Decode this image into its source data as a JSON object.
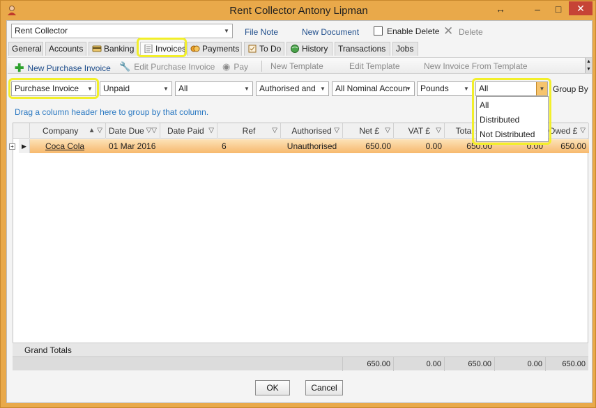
{
  "window": {
    "title": "Rent Collector Antony Lipman",
    "move_glyph": "↔",
    "min_glyph": "–",
    "max_glyph": "□",
    "close_glyph": "✕"
  },
  "top": {
    "record_select": "Rent Collector",
    "file_note": "File Note",
    "new_document": "New Document",
    "enable_delete_label": "Enable Delete",
    "delete_label": "Delete"
  },
  "tabs": [
    {
      "label": "General"
    },
    {
      "label": "Accounts"
    },
    {
      "label": "Banking"
    },
    {
      "label": "Invoices"
    },
    {
      "label": "Payments"
    },
    {
      "label": "To Do"
    },
    {
      "label": "History"
    },
    {
      "label": "Transactions"
    },
    {
      "label": "Jobs"
    }
  ],
  "toolbar": {
    "new_purchase_invoice": "New Purchase Invoice",
    "edit_purchase_invoice": "Edit Purchase Invoice",
    "pay": "Pay",
    "new_template": "New  Template",
    "edit_template": "Edit Template",
    "new_invoice_from_template": "New Invoice From Template"
  },
  "filters": {
    "invoice_type": "Purchase Invoice",
    "status": "Unpaid",
    "period": "All",
    "authorised": "Authorised and",
    "nominal": "All Nominal Accoun",
    "currency": "Pounds",
    "distribution": "All",
    "group_by_label": "Group By"
  },
  "distribution_options": [
    "All",
    "Distributed",
    "Not Distributed"
  ],
  "grid": {
    "drag_hint": "Drag a column header here to group by that column.",
    "columns": [
      "Company",
      "Date Due",
      "Date Paid",
      "Ref",
      "Authorised",
      "Net £",
      "VAT £",
      "Total £",
      "",
      "Owed £"
    ],
    "rows": [
      {
        "company": "Coca Cola",
        "date_due": "01 Mar 2016",
        "date_paid": "",
        "ref": "6",
        "authorised": "Unauthorised",
        "net": "650.00",
        "vat": "0.00",
        "total": "650.00",
        "col9": "0.00",
        "owed": "650.00"
      }
    ],
    "grand_totals_label": "Grand Totals",
    "totals": {
      "net": "650.00",
      "vat": "0.00",
      "total": "650.00",
      "col9": "0.00",
      "owed": "650.00"
    }
  },
  "buttons": {
    "ok": "OK",
    "cancel": "Cancel"
  },
  "colors": {
    "row_selected": "#f7b96d",
    "highlight": "#f2ef2a",
    "window_frame": "#e9a94a"
  }
}
